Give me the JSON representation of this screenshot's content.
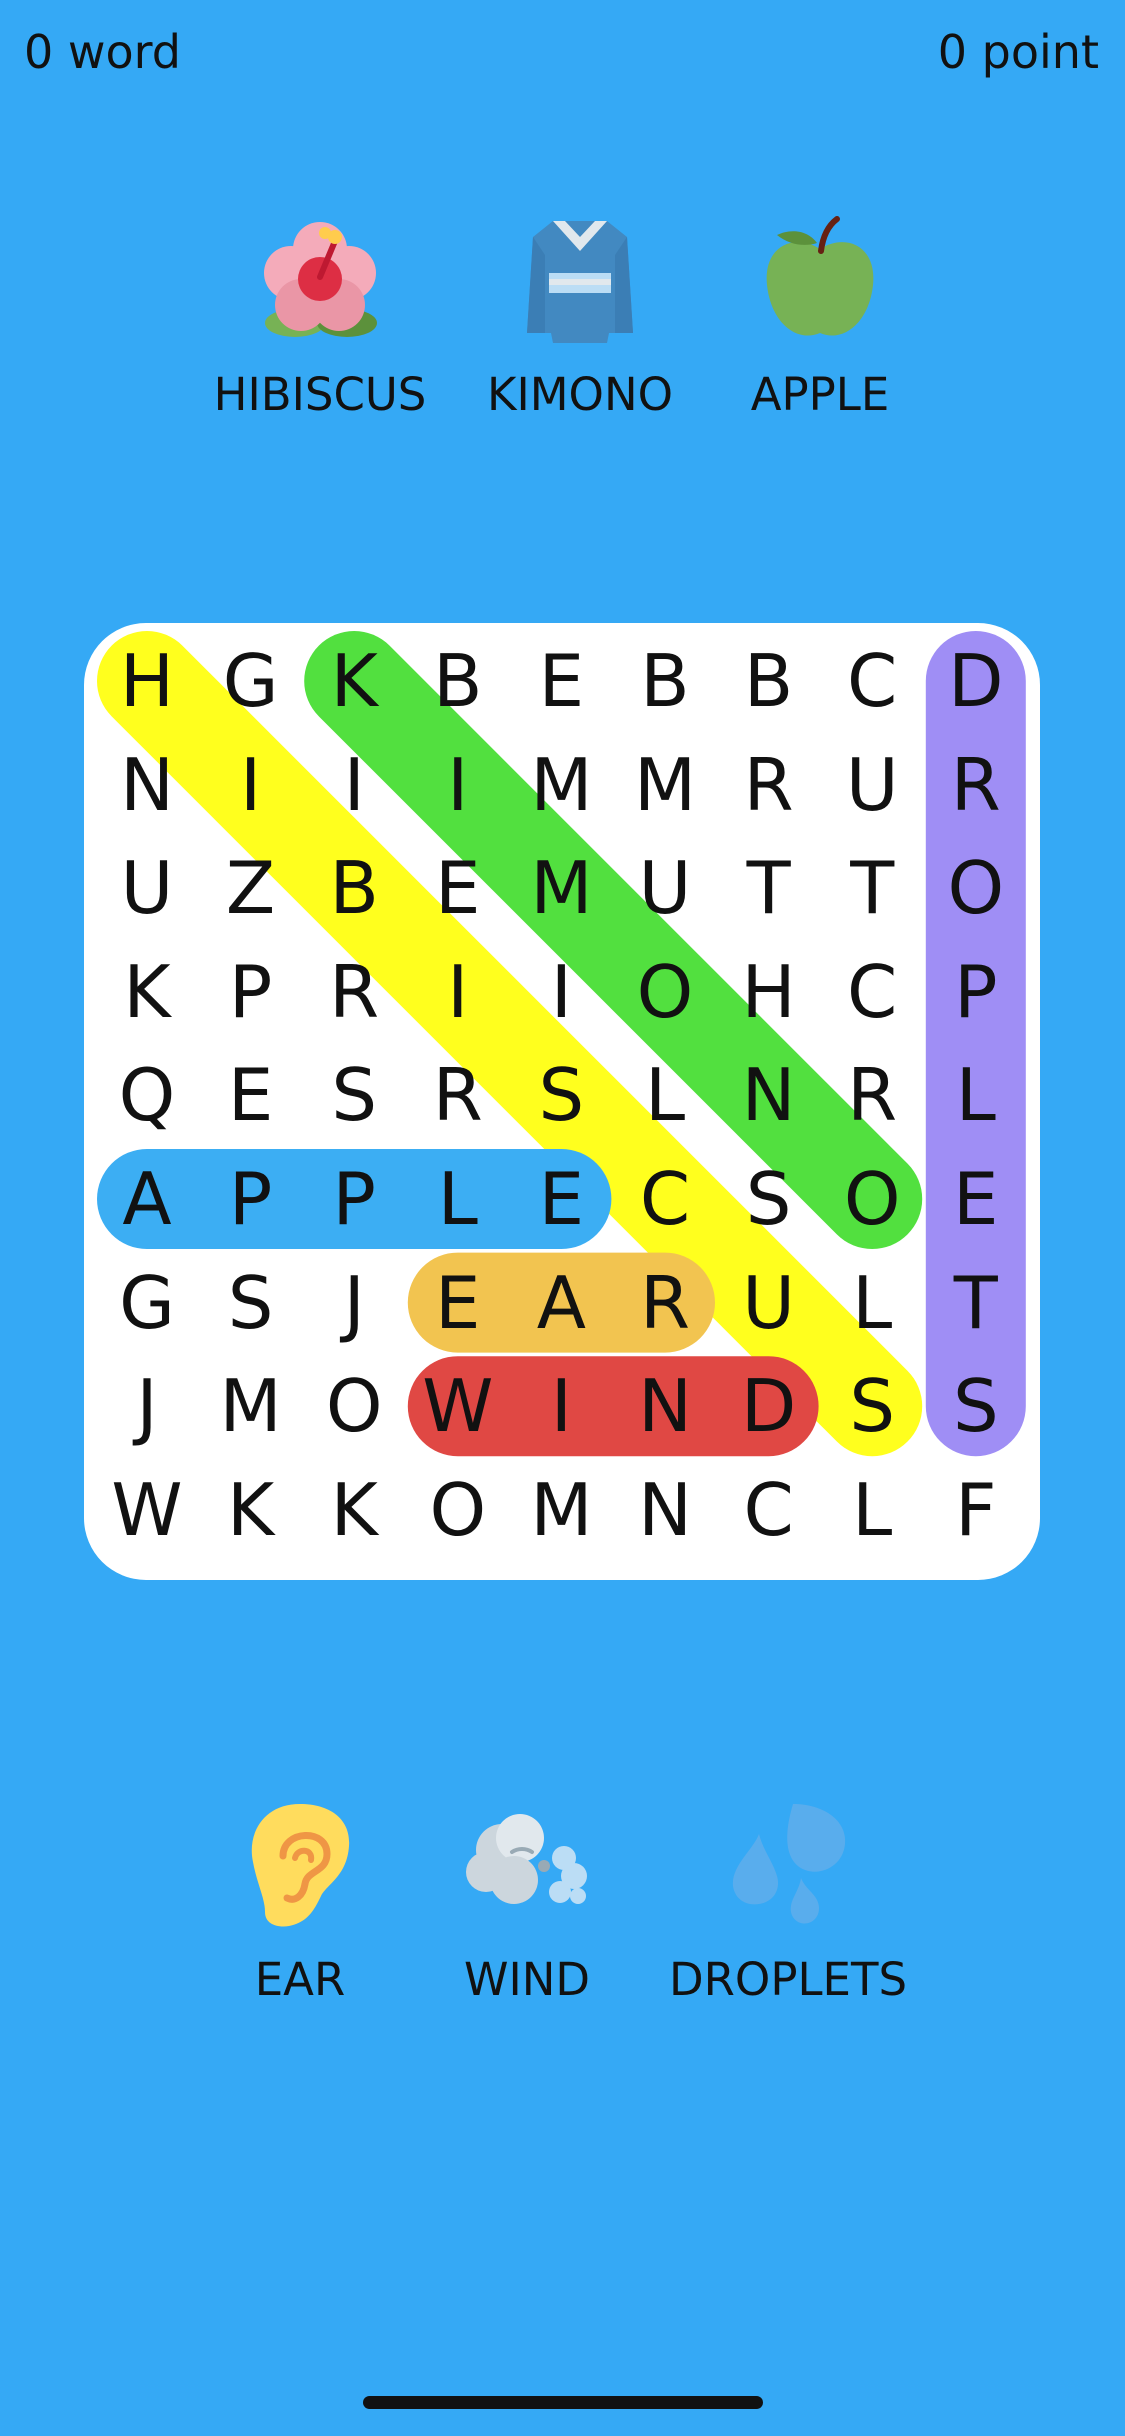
{
  "header": {
    "words_label": "0 word",
    "points_label": "0 point"
  },
  "top_words": [
    {
      "label": "HIBISCUS",
      "icon": "hibiscus-icon",
      "found": true
    },
    {
      "label": "KIMONO",
      "icon": "kimono-icon",
      "found": true
    },
    {
      "label": "APPLE",
      "icon": "green-apple-icon",
      "found": true
    }
  ],
  "bottom_words": [
    {
      "label": "EAR",
      "icon": "ear-icon",
      "found": true
    },
    {
      "label": "WIND",
      "icon": "wind-face-icon",
      "found": true
    },
    {
      "label": "DROPLETS",
      "icon": "sweat-droplets-icon",
      "found": true
    }
  ],
  "grid": [
    [
      "H",
      "G",
      "K",
      "B",
      "E",
      "B",
      "B",
      "C",
      "D"
    ],
    [
      "N",
      "I",
      "I",
      "I",
      "M",
      "M",
      "R",
      "U",
      "R"
    ],
    [
      "U",
      "Z",
      "B",
      "E",
      "M",
      "U",
      "T",
      "T",
      "O"
    ],
    [
      "K",
      "P",
      "R",
      "I",
      "I",
      "O",
      "H",
      "C",
      "P"
    ],
    [
      "Q",
      "E",
      "S",
      "R",
      "S",
      "L",
      "N",
      "R",
      "L"
    ],
    [
      "A",
      "P",
      "P",
      "L",
      "E",
      "C",
      "S",
      "O",
      "E"
    ],
    [
      "G",
      "S",
      "J",
      "E",
      "A",
      "R",
      "U",
      "L",
      "T"
    ],
    [
      "J",
      "M",
      "O",
      "W",
      "I",
      "N",
      "D",
      "S",
      "S"
    ],
    [
      "W",
      "K",
      "K",
      "O",
      "M",
      "N",
      "C",
      "L",
      "F"
    ]
  ],
  "found_paths": [
    {
      "word": "HIBISCUS",
      "from": [
        0,
        0
      ],
      "to": [
        7,
        7
      ],
      "color": "#FFFF1E"
    },
    {
      "word": "KIMONO",
      "from": [
        0,
        2
      ],
      "to": [
        5,
        7
      ],
      "color": "#52E03F"
    },
    {
      "word": "DROPLETS",
      "from": [
        0,
        8
      ],
      "to": [
        7,
        8
      ],
      "color": "#9F8EF5"
    },
    {
      "word": "APPLE",
      "from": [
        5,
        0
      ],
      "to": [
        5,
        4
      ],
      "color": "#3CAEF3"
    },
    {
      "word": "EAR",
      "from": [
        6,
        3
      ],
      "to": [
        6,
        5
      ],
      "color": "#F2C450"
    },
    {
      "word": "WIND",
      "from": [
        7,
        3
      ],
      "to": [
        7,
        6
      ],
      "color": "#E04844"
    }
  ]
}
